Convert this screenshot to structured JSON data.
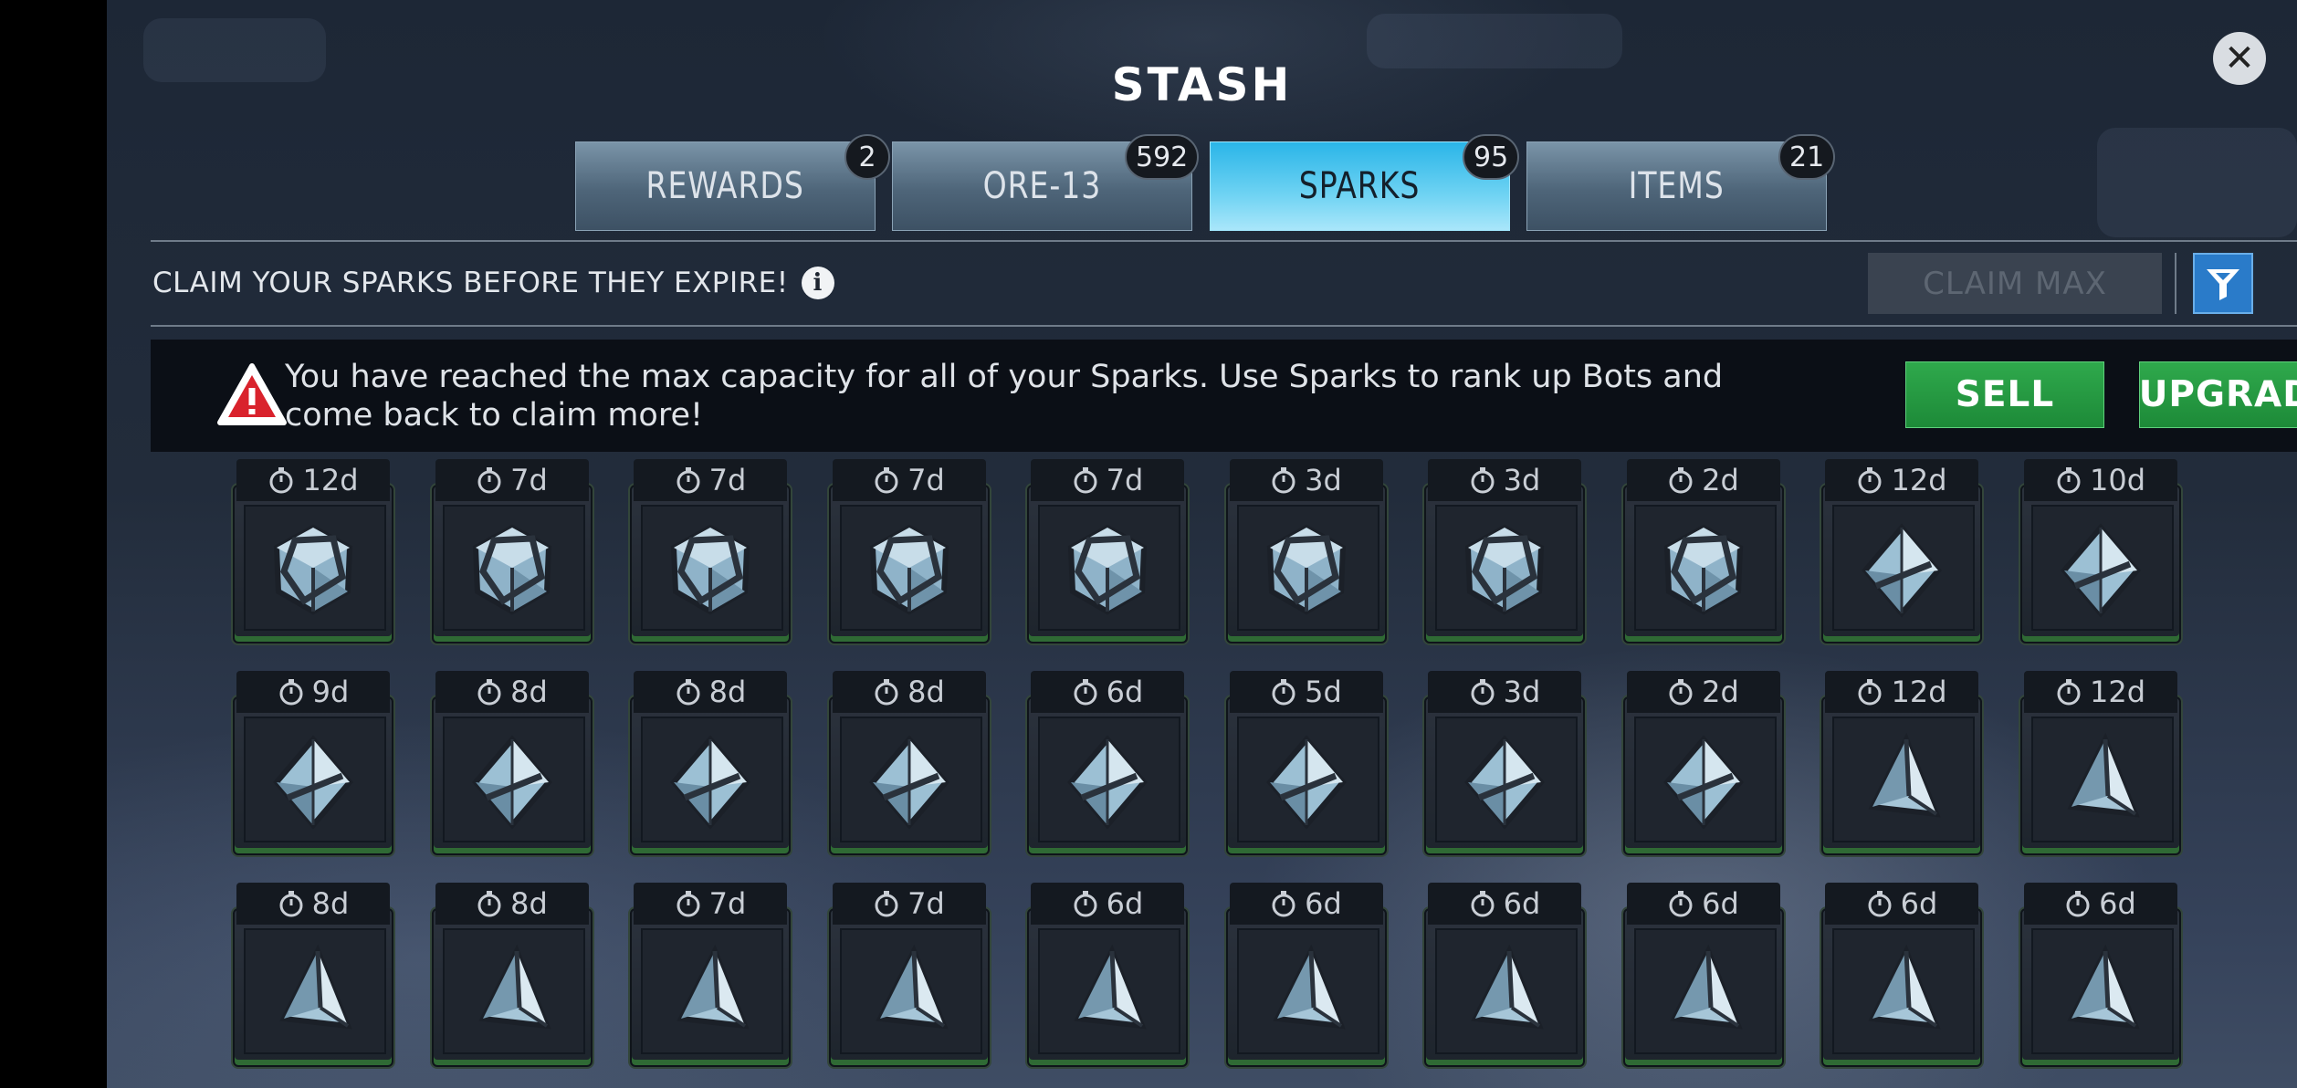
{
  "header": {
    "title": "STASH"
  },
  "tabs": [
    {
      "label": "REWARDS",
      "count": "2",
      "active": false
    },
    {
      "label": "ORE-13",
      "count": "592",
      "active": false
    },
    {
      "label": "SPARKS",
      "count": "95",
      "active": true
    },
    {
      "label": "ITEMS",
      "count": "21",
      "active": false
    }
  ],
  "toolbar": {
    "message": "CLAIM YOUR SPARKS BEFORE THEY EXPIRE!",
    "claim_max_label": "CLAIM MAX"
  },
  "alert": {
    "text": "You have reached the max capacity for all of your Sparks. Use Sparks to rank up Bots and come back to claim more!",
    "sell_label": "SELL",
    "upgrade_label": "UPGRADE"
  },
  "sparks": {
    "rows": [
      [
        {
          "timer": "12d",
          "shape": "cube"
        },
        {
          "timer": "7d",
          "shape": "cube"
        },
        {
          "timer": "7d",
          "shape": "cube"
        },
        {
          "timer": "7d",
          "shape": "cube"
        },
        {
          "timer": "7d",
          "shape": "cube"
        },
        {
          "timer": "3d",
          "shape": "cube"
        },
        {
          "timer": "3d",
          "shape": "cube"
        },
        {
          "timer": "2d",
          "shape": "cube"
        },
        {
          "timer": "12d",
          "shape": "octa"
        },
        {
          "timer": "10d",
          "shape": "octa"
        }
      ],
      [
        {
          "timer": "9d",
          "shape": "octa"
        },
        {
          "timer": "8d",
          "shape": "octa"
        },
        {
          "timer": "8d",
          "shape": "octa"
        },
        {
          "timer": "8d",
          "shape": "octa"
        },
        {
          "timer": "6d",
          "shape": "octa"
        },
        {
          "timer": "5d",
          "shape": "octa"
        },
        {
          "timer": "3d",
          "shape": "octa"
        },
        {
          "timer": "2d",
          "shape": "octa"
        },
        {
          "timer": "12d",
          "shape": "tetra"
        },
        {
          "timer": "12d",
          "shape": "tetra"
        }
      ],
      [
        {
          "timer": "8d",
          "shape": "tetra"
        },
        {
          "timer": "8d",
          "shape": "tetra"
        },
        {
          "timer": "7d",
          "shape": "tetra"
        },
        {
          "timer": "7d",
          "shape": "tetra"
        },
        {
          "timer": "6d",
          "shape": "tetra"
        },
        {
          "timer": "6d",
          "shape": "tetra"
        },
        {
          "timer": "6d",
          "shape": "tetra"
        },
        {
          "timer": "6d",
          "shape": "tetra"
        },
        {
          "timer": "6d",
          "shape": "tetra"
        },
        {
          "timer": "6d",
          "shape": "tetra"
        }
      ]
    ]
  },
  "icons": {
    "close": "close-icon",
    "info": "info-icon",
    "filter": "filter-icon",
    "warning": "warning-icon",
    "timer": "stopwatch-icon"
  },
  "colors": {
    "active_tab": "#4cc6ef",
    "green_button": "#22963f",
    "warning_red": "#d9222c",
    "filter_button": "#2a7bc9"
  }
}
